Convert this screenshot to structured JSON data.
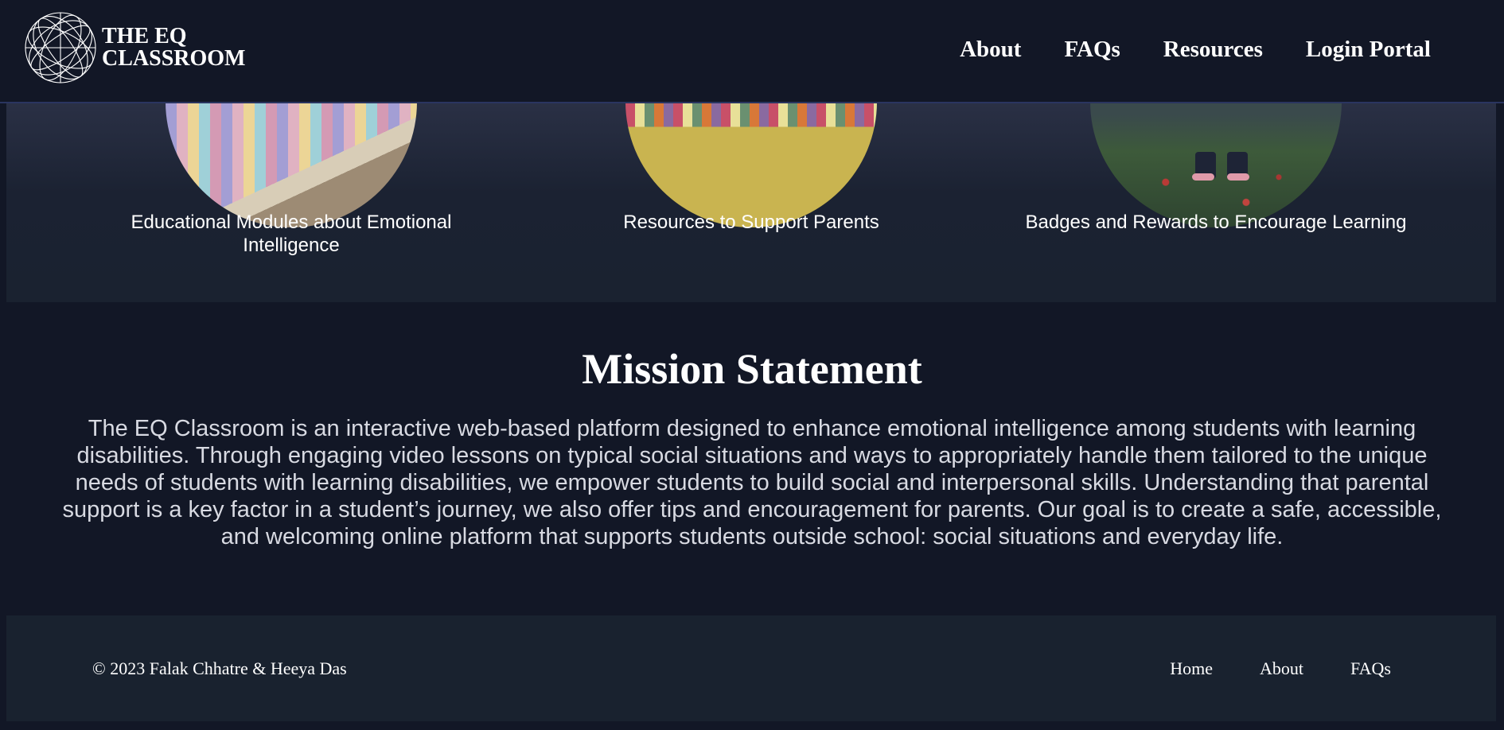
{
  "header": {
    "logo": {
      "icon": "globe-icon",
      "line1": "THE EQ",
      "line2": "CLASSROOM"
    },
    "nav": [
      {
        "label": "About"
      },
      {
        "label": "FAQs"
      },
      {
        "label": "Resources"
      },
      {
        "label": "Login Portal"
      }
    ]
  },
  "features": [
    {
      "label": "Educational Modules about Emotional Intelligence",
      "image": "pastel-chalk-photo"
    },
    {
      "label": "Resources to Support Parents",
      "image": "crayons-photo"
    },
    {
      "label": "Badges and Rewards to Encourage Learning",
      "image": "poppy-meadow-photo"
    }
  ],
  "mission": {
    "title": "Mission Statement",
    "body": "The EQ Classroom is an interactive web-based platform designed to enhance emotional intelligence among students with learning disabilities. Through engaging video lessons on typical social situations and ways to appropriately handle them tailored to the unique needs of students with learning disabilities, we empower students to build social and interpersonal skills. Understanding that parental support is a key factor in a student’s journey, we also offer tips and encouragement for parents. Our goal is to create a safe, accessible, and welcoming online platform that supports students outside school: social situations and everyday life."
  },
  "footer": {
    "copyright": "© 2023 Falak Chhatre & Heeya Das",
    "links": [
      {
        "label": "Home"
      },
      {
        "label": "About"
      },
      {
        "label": "FAQs"
      }
    ]
  },
  "colors": {
    "page_background": "#121726",
    "header_border": "#2a3560",
    "band_background": "#1a2230",
    "footer_background": "#19222f",
    "text": "#ffffff",
    "body_text": "#d8dae2"
  }
}
